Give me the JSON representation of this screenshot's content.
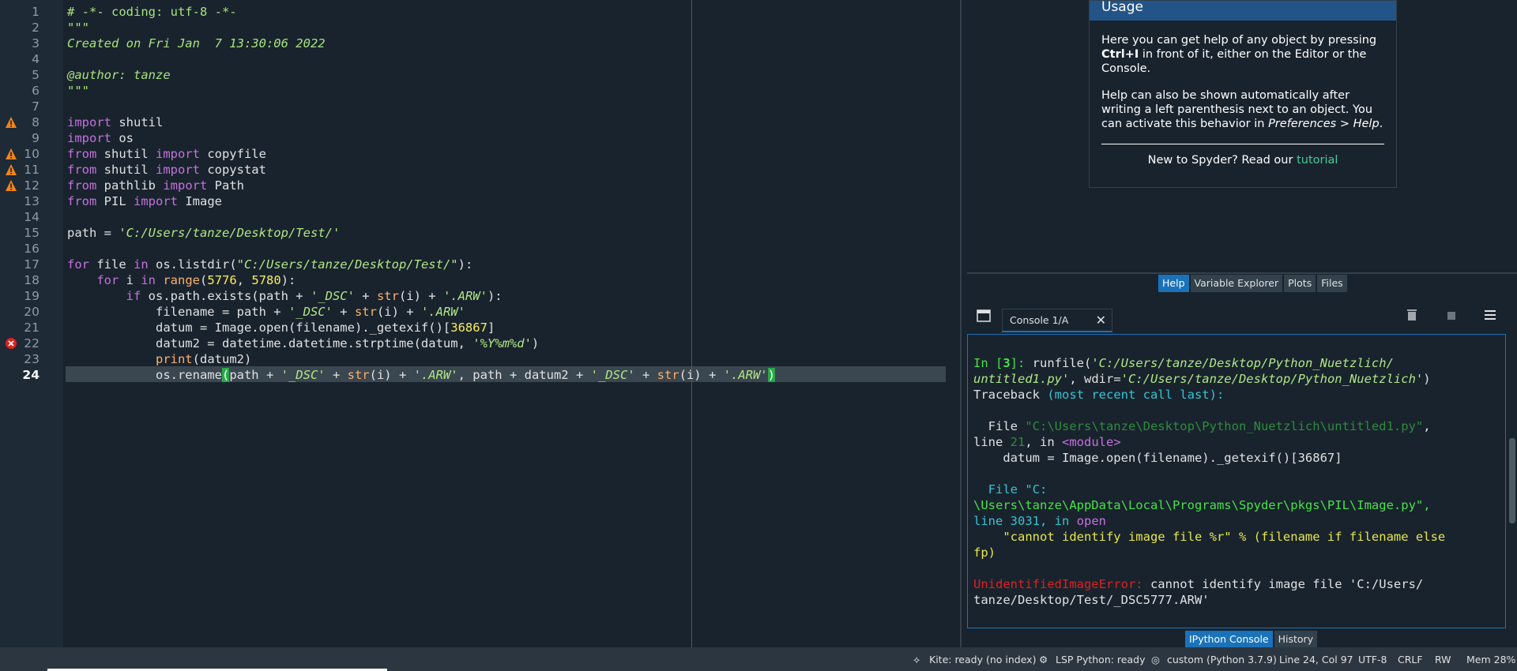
{
  "editor": {
    "line_numbers": [
      "1",
      "2",
      "3",
      "4",
      "5",
      "6",
      "7",
      "8",
      "9",
      "10",
      "11",
      "12",
      "13",
      "14",
      "15",
      "16",
      "17",
      "18",
      "19",
      "20",
      "21",
      "22",
      "23",
      "24"
    ],
    "current_line": "24",
    "lines": {
      "l1": "# -*- coding: utf-8 -*-",
      "l2": "\"\"\"",
      "l3": "Created on Fri Jan  7 13:30:06 2022",
      "l5": "@author: tanze",
      "l6": "\"\"\"",
      "l8_kw": "import",
      "l8_rest": " shutil",
      "l9_kw": "import",
      "l9_rest": " os",
      "l10_kw1": "from",
      "l10_mod": " shutil ",
      "l10_kw2": "import",
      "l10_rest": " copyfile",
      "l11_kw1": "from",
      "l11_mod": " shutil ",
      "l11_kw2": "import",
      "l11_rest": " copystat",
      "l12_kw1": "from",
      "l12_mod": " pathlib ",
      "l12_kw2": "import",
      "l12_rest": " Path",
      "l13_kw1": "from",
      "l13_mod": " PIL ",
      "l13_kw2": "import",
      "l13_rest": " Image",
      "l15_a": "path = ",
      "l15_s": "'C:/Users/tanze/Desktop/Test/'",
      "l17_kw1": "for",
      "l17_a": " file ",
      "l17_kw2": "in",
      "l17_b": " os.listdir(",
      "l17_s": "\"C:/Users/tanze/Desktop/Test/\"",
      "l17_c": "):",
      "l18_ind": "    ",
      "l18_kw1": "for",
      "l18_a": " i ",
      "l18_kw2": "in",
      "l18_sp": " ",
      "l18_bi": "range",
      "l18_b": "(",
      "l18_n1": "5776",
      "l18_c": ", ",
      "l18_n2": "5780",
      "l18_d": "):",
      "l19_ind": "        ",
      "l19_kw": "if",
      "l19_a": " os.path.exists(path + ",
      "l19_s1": "'_DSC'",
      "l19_b": " + ",
      "l19_bi": "str",
      "l19_c": "(i) + ",
      "l19_s2": "'.ARW'",
      "l19_d": "):",
      "l20_a": "            filename = path + ",
      "l20_s1": "'_DSC'",
      "l20_b": " + ",
      "l20_bi": "str",
      "l20_c": "(i) + ",
      "l20_s2": "'.ARW'",
      "l21_a": "            datum = Image.open(filename)._getexif()[",
      "l21_n": "36867",
      "l21_b": "]",
      "l22_a": "            datum2 = datetime.datetime.strptime(datum, ",
      "l22_s": "'%Y%m%d'",
      "l22_b": ")",
      "l23_ind": "            ",
      "l23_bi": "print",
      "l23_a": "(datum2)",
      "l24_a": "            os.rename",
      "l24_br1": "(",
      "l24_b": "path + ",
      "l24_s1": "'_DSC'",
      "l24_c": " + ",
      "l24_bi1": "str",
      "l24_d": "(i) + ",
      "l24_s2": "'.ARW'",
      "l24_e": ", path + datum2 + ",
      "l24_s3": "'_DSC'",
      "l24_f": " + ",
      "l24_bi2": "str",
      "l24_g": "(i) + ",
      "l24_s4": "'.ARW'",
      "l24_br2": ")"
    },
    "warning_lines": [
      "8",
      "10",
      "11",
      "12"
    ],
    "error_lines": [
      "22"
    ],
    "colors": {
      "warning": "#f0841c",
      "error": "#e02020"
    }
  },
  "help": {
    "title": "Usage",
    "p1_a": "Here you can get help of any object by pressing ",
    "p1_key": "Ctrl+I",
    "p1_b": " in front of it, either on the Editor or the Console.",
    "p2_a": "Help can also be shown automatically after writing a left parenthesis next to an object. You can activate this behavior in ",
    "p2_em": "Preferences > Help",
    "p2_b": ".",
    "footer_a": "New to Spyder? Read our ",
    "footer_link": "tutorial",
    "tabs": [
      "Help",
      "Variable Explorer",
      "Plots",
      "Files"
    ]
  },
  "console": {
    "tab_label": "Console 1/A",
    "lines": {
      "c1_in": "In [",
      "c1_num": "3",
      "c1_close": "]: ",
      "c1_a": "runfile(",
      "c1_s1": "'C:/Users/tanze/Desktop/Python_Nuetzlich/",
      "c2_s1": "untitled1.py'",
      "c2_a": ", wdir=",
      "c2_s2": "'C:/Users/tanze/Desktop/Python_Nuetzlich'",
      "c2_b": ")",
      "c3_a": "Traceback ",
      "c3_b": "(most recent call last):",
      "c5_a": "  File ",
      "c5_s": "\"C:\\Users\\tanze\\Desktop\\Python_Nuetzlich\\untitled1.py\"",
      "c5_b": ",",
      "c6_a": "line ",
      "c6_n": "21",
      "c6_b": ", in ",
      "c6_m": "<module>",
      "c7": "    datum = Image.open(filename)._getexif()[36867]",
      "c9": "  File \"C:",
      "c10": "\\Users\\tanze\\AppData\\Local\\Programs\\Spyder\\pkgs\\PIL\\Image.py\",",
      "c11_a": "line 3031, in ",
      "c11_m": "open",
      "c12": "    \"cannot identify image file %r\" % (filename if filename else",
      "c13": "fp)",
      "c15_err": "UnidentifiedImageError:",
      "c15_a": " cannot identify image file 'C:/Users/",
      "c16": "tanze/Desktop/Test/_DSC5777.ARW'"
    },
    "tabs": [
      "IPython Console",
      "History"
    ]
  },
  "statusbar": {
    "kite": "Kite: ready (no index)",
    "lsp": "LSP Python: ready",
    "env": "custom (Python 3.7.9)",
    "position": "Line 24, Col 97",
    "encoding": "UTF-8",
    "eol": "CRLF",
    "rw": "RW",
    "mem": "Mem 28%"
  }
}
